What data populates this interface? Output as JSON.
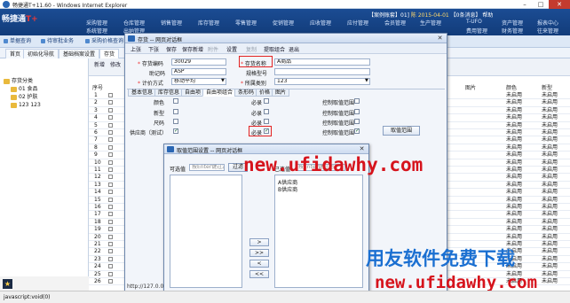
{
  "browser": {
    "title": "畅捷通T+11.60 - Windows Internet Explorer",
    "min": "–",
    "max": "□",
    "close": "✕"
  },
  "app": {
    "brand": "畅捷通",
    "brand_mark": "T+",
    "nav": [
      "采购管理",
      "仓库管理",
      "销售管理",
      "库存管理",
      "零售管理",
      "促销管理",
      "应收管理",
      "应付管理",
      "会员管理",
      "生产管理",
      "T-UFO",
      "资产管理",
      "报表中心",
      "系统管理",
      "出纳管理",
      "费用管理",
      "财务管理",
      "往来管理",
      "基础设置"
    ],
    "user": {
      "account": "【案例账套】01]",
      "name": "陈",
      "date": "2015-04-01",
      "notice": "【0条消息】",
      "help": "帮助"
    }
  },
  "quick": [
    "单据查询",
    "待审批业务",
    "采购价格查询"
  ],
  "tabs": {
    "home": "首页",
    "guide": "初始化导航",
    "archive": "基础档案设置",
    "stock": "存货"
  },
  "tree": {
    "root": "存货分类",
    "items": [
      "01 食品",
      "02 护肤",
      "123 123"
    ]
  },
  "grid": {
    "toolbar": [
      "新增",
      "修改"
    ],
    "columns": {
      "num": "序号",
      "pic": "图片",
      "color": "颜色",
      "style": "新型"
    },
    "rows": [
      {
        "n": "1",
        "s": "未启用",
        "t": "未启用"
      },
      {
        "n": "2",
        "s": "未启用",
        "t": "未启用"
      },
      {
        "n": "3",
        "s": "未启用",
        "t": "未启用"
      },
      {
        "n": "4",
        "s": "未启用",
        "t": "未启用"
      },
      {
        "n": "5",
        "s": "未启用",
        "t": "未启用"
      },
      {
        "n": "6",
        "s": "未启用",
        "t": "未启用"
      },
      {
        "n": "7",
        "s": "未启用",
        "t": "未启用"
      },
      {
        "n": "8",
        "s": "未启用",
        "t": "未启用"
      },
      {
        "n": "9",
        "s": "未启用",
        "t": "未启用"
      },
      {
        "n": "10",
        "s": "未启用",
        "t": "未启用"
      },
      {
        "n": "11",
        "s": "未启用",
        "t": "未启用"
      },
      {
        "n": "12",
        "s": "未启用",
        "t": "未启用"
      },
      {
        "n": "13",
        "s": "未启用",
        "t": "未启用"
      },
      {
        "n": "14",
        "s": "未启用",
        "t": "未启用"
      },
      {
        "n": "15",
        "s": "未启用",
        "t": "未启用"
      },
      {
        "n": "16",
        "s": "未启用",
        "t": "未启用"
      },
      {
        "n": "17",
        "s": "未启用",
        "t": "未启用"
      },
      {
        "n": "18",
        "s": "未启用",
        "t": "未启用"
      },
      {
        "n": "19",
        "s": "未启用",
        "t": "未启用"
      },
      {
        "n": "20",
        "s": "未启用",
        "t": "未启用"
      },
      {
        "n": "21",
        "s": "未启用",
        "t": "未启用"
      },
      {
        "n": "22",
        "s": "未启用",
        "t": "未启用"
      },
      {
        "n": "23",
        "s": "未启用",
        "t": "未启用"
      },
      {
        "n": "24",
        "s": "未启用",
        "t": "未启用"
      },
      {
        "n": "25",
        "s": "未启用",
        "t": "未启用"
      },
      {
        "n": "26",
        "s": "未启用",
        "t": "未启用"
      }
    ]
  },
  "dialog1": {
    "title": "存货 -- 网页对话框",
    "toolbar": [
      "上张",
      "下张",
      "保存",
      "保存新增",
      "附件",
      "设置",
      "复制",
      "提取组合",
      "退出"
    ],
    "code_label": "存货编码",
    "code_value": "30029",
    "name_label": "存货名称",
    "name_value": "A商品",
    "mnemonic_label": "助记码",
    "mnemonic_value": "ASP",
    "spec_label": "规格型号",
    "spec_value": "",
    "valuation_label": "计价方式",
    "valuation_value": "移动平均",
    "category_label": "所属类别",
    "category_value": "123",
    "subtabs": [
      "基本信息",
      "库存信息",
      "自由项",
      "自由项组合",
      "条形码",
      "价格",
      "图片"
    ],
    "rows": [
      {
        "label": "颜色",
        "req": "必录",
        "ctrl": "控制取值范围"
      },
      {
        "label": "新型",
        "req": "必录",
        "ctrl": "控制取值范围"
      },
      {
        "label": "尺码",
        "req": "必录",
        "ctrl": "控制取值范围"
      },
      {
        "label": "供应商（测试）",
        "req": "必录",
        "ctrl": "控制取值范围"
      }
    ],
    "range_button": "取值范围",
    "url": "http://127.0.0.1"
  },
  "dialog2": {
    "title": "取值范围设置 -- 网页对话框",
    "left_label": "可选值",
    "left_placeholder": "按Enter键过滤",
    "filter_button": "过滤",
    "right_label": "已选值",
    "right_placeholder": "按Enter键过滤",
    "selected": [
      "A供应商",
      "B供应商"
    ],
    "move": [
      ">",
      ">>",
      "<",
      "<<"
    ]
  },
  "watermark": {
    "url_mid": "new.ufidawhy.com",
    "brand": "用友软件免费下载",
    "url_bottom": "new.ufidawhy.com"
  },
  "status": {
    "text": "javascript:void(0)"
  },
  "colors": {
    "header": "#1b4c93",
    "highlight": "#e32222",
    "watermark_red": "#d6131c",
    "watermark_blue": "#1a6fd1"
  }
}
